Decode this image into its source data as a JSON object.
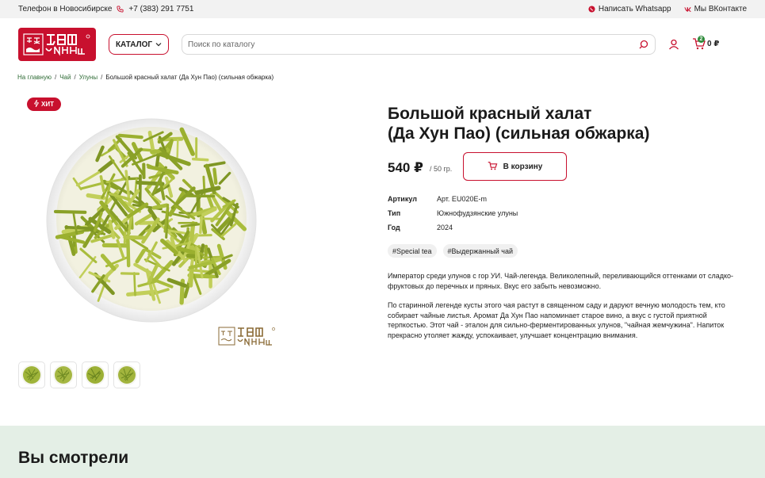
{
  "topbar": {
    "phone_label": "Телефон в Новосибирске",
    "phone": "+7 (383) 291 7751",
    "whatsapp": "Написать Whatsapp",
    "vk": "Мы ВКонтакте"
  },
  "header": {
    "catalog_label": "КАТАЛОГ",
    "search_placeholder": "Поиск по каталогу",
    "cart_count": "2",
    "cart_total": "0 ₽"
  },
  "breadcrumb": {
    "items": [
      "На главную",
      "Чай",
      "Улуны"
    ],
    "current": "Большой красный халат (Да Хун Пао) (сильная обжарка)"
  },
  "product": {
    "badge": "ХИТ",
    "title_line1": "Большой красный халат",
    "title_line2": "(Да Хун Пао) (сильная обжарка)",
    "price": "540 ₽",
    "unit": "/ 50 гр.",
    "add_to_cart": "В корзину",
    "specs": [
      {
        "key": "Артикул",
        "value": "Арт. EU020E-m"
      },
      {
        "key": "Тип",
        "value": "Южнофудзянские улуны"
      },
      {
        "key": "Год",
        "value": "2024"
      }
    ],
    "tags": [
      "#Special tea",
      "#Выдержанный чай"
    ],
    "description": [
      "Император среди улунов с гор УИ. Чай-легенда. Великолепный, переливающийся оттенками от сладко-фруктовых до перечных и пряных. Вкус его забыть невозможно.",
      "По старинной легенде кусты этого чая растут в священном саду и даруют вечную молодость тем, кто собирает чайные листья. Аромат Да Хун Пао напоминает старое вино, а вкус с густой приятной терпкостью. Этот чай -  эталон для сильно-ферментированных улунов, \"чайная жемчужина\". Напиток прекрасно утоляет жажду, успокаивает, улучшает концентрацию внимания."
    ]
  },
  "recently_viewed": {
    "title": "Вы смотрели"
  },
  "colors": {
    "brand_red": "#c8102e",
    "link_green": "#2e6b35",
    "section_green": "#e4efe6"
  }
}
